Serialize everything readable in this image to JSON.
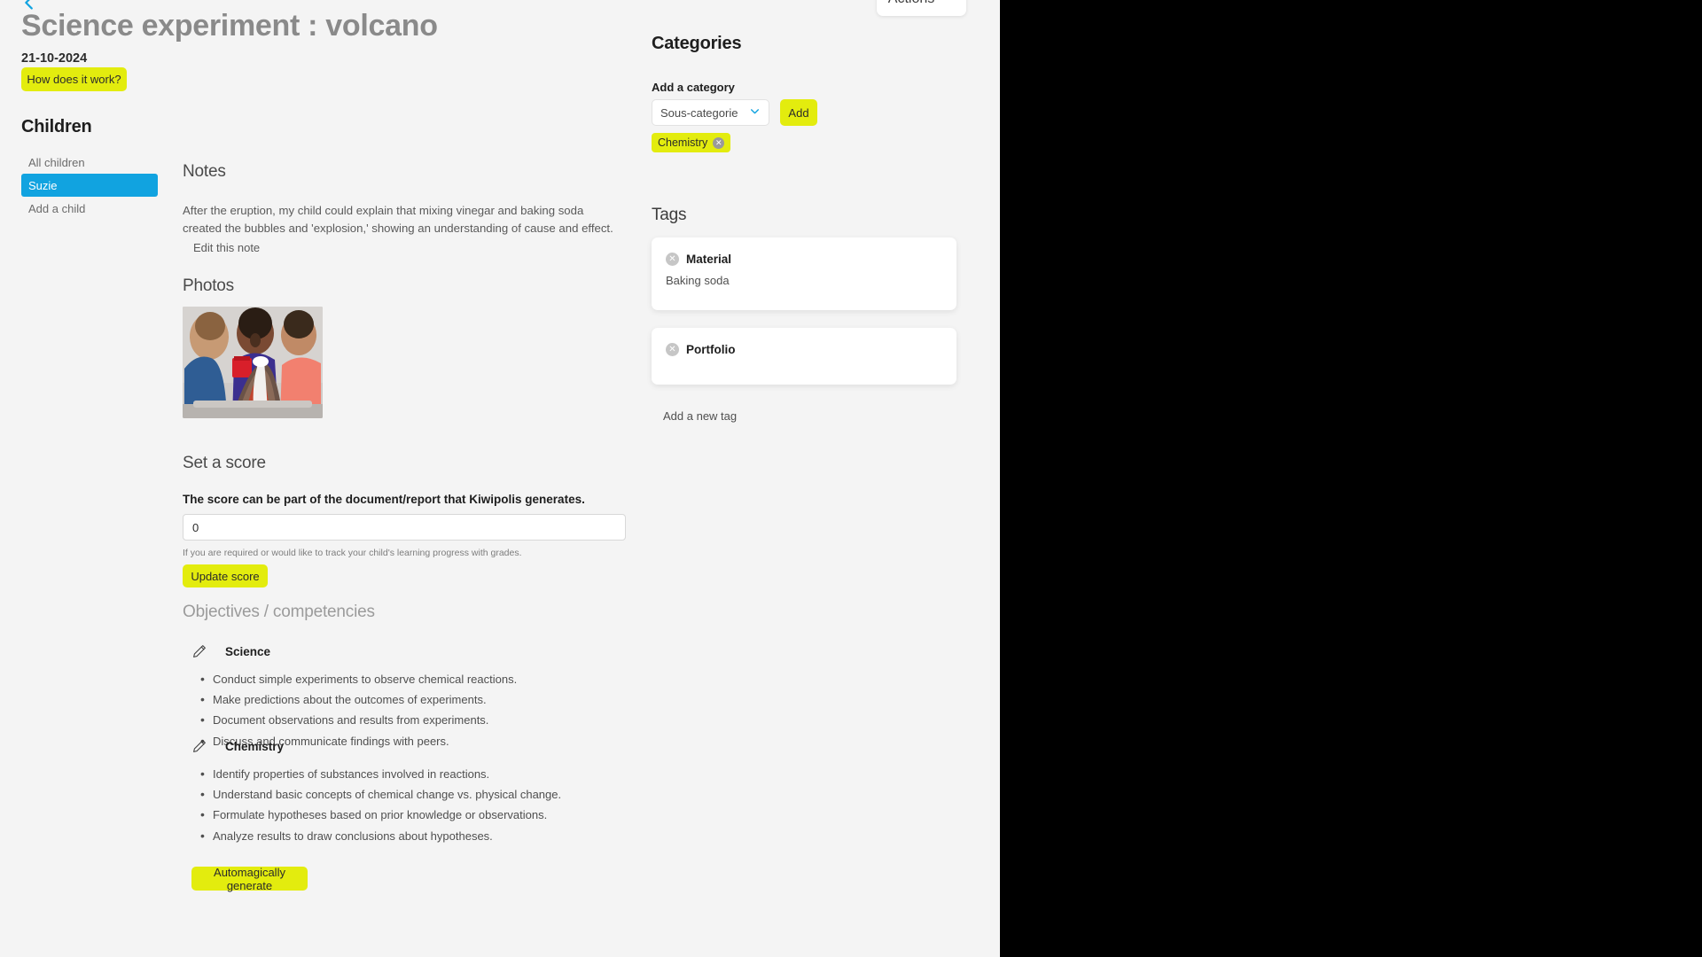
{
  "topbar": {
    "back_icon": "chevron-left-icon",
    "actions_label": "Actions",
    "actions_chevron_icon": "chevron-down-icon"
  },
  "header": {
    "title": "Science experiment : volcano",
    "date": "21-10-2024",
    "how_it_works_label": "How does it work?"
  },
  "sidebar": {
    "heading": "Children",
    "items": [
      {
        "label": "All children",
        "active": false
      },
      {
        "label": "Suzie",
        "active": true
      },
      {
        "label": "Add a child",
        "active": false
      }
    ]
  },
  "notes": {
    "heading": "Notes",
    "body": "After the eruption, my child could explain that mixing vinegar and baking soda created the bubbles and 'explosion,' showing an understanding of cause and effect.",
    "edit_label": "Edit this note"
  },
  "photos": {
    "heading": "Photos",
    "alt": "Three children watching an erupting model volcano"
  },
  "score": {
    "heading": "Set a score",
    "label": "The score can be part of the document/report that Kiwipolis generates.",
    "value": "0",
    "placeholder": "0",
    "help": "If you are required or would like to track your child's learning progress with grades.",
    "update_label": "Update score"
  },
  "objectives": {
    "heading": "Objectives / competencies",
    "groups": [
      {
        "title": "Science",
        "edit_icon": "pencil-icon",
        "items": [
          "Conduct simple experiments to observe chemical reactions.",
          "Make predictions about the outcomes of experiments.",
          "Document observations and results from experiments.",
          "Discuss and communicate findings with peers."
        ]
      },
      {
        "title": "Chemistry",
        "edit_icon": "pencil-icon",
        "items": [
          "Identify properties of substances involved in reactions.",
          "Understand basic concepts of chemical change vs. physical change.",
          "Formulate hypotheses based on prior knowledge or observations.",
          "Analyze results to draw conclusions about hypotheses."
        ]
      }
    ],
    "generate_label": "Automagically generate"
  },
  "categories": {
    "heading": "Categories",
    "sub_label": "Add a category",
    "select_value": "Sous-categorie",
    "select_chevron_icon": "chevron-down-icon",
    "add_label": "Add",
    "chips": [
      {
        "label": "Chemistry",
        "remove_icon": "close-circle-icon"
      }
    ]
  },
  "tags": {
    "heading": "Tags",
    "cards": [
      {
        "name": "Material",
        "value": "Baking soda",
        "remove_icon": "close-circle-icon"
      },
      {
        "name": "Portfolio",
        "value": "",
        "remove_icon": "close-circle-icon"
      }
    ],
    "add_label": "Add a new tag"
  },
  "colors": {
    "accent_yellow": "#e3ec0e",
    "accent_blue": "#11a3e0",
    "page_bg": "#f4f4f4",
    "card_bg": "#ffffff"
  }
}
